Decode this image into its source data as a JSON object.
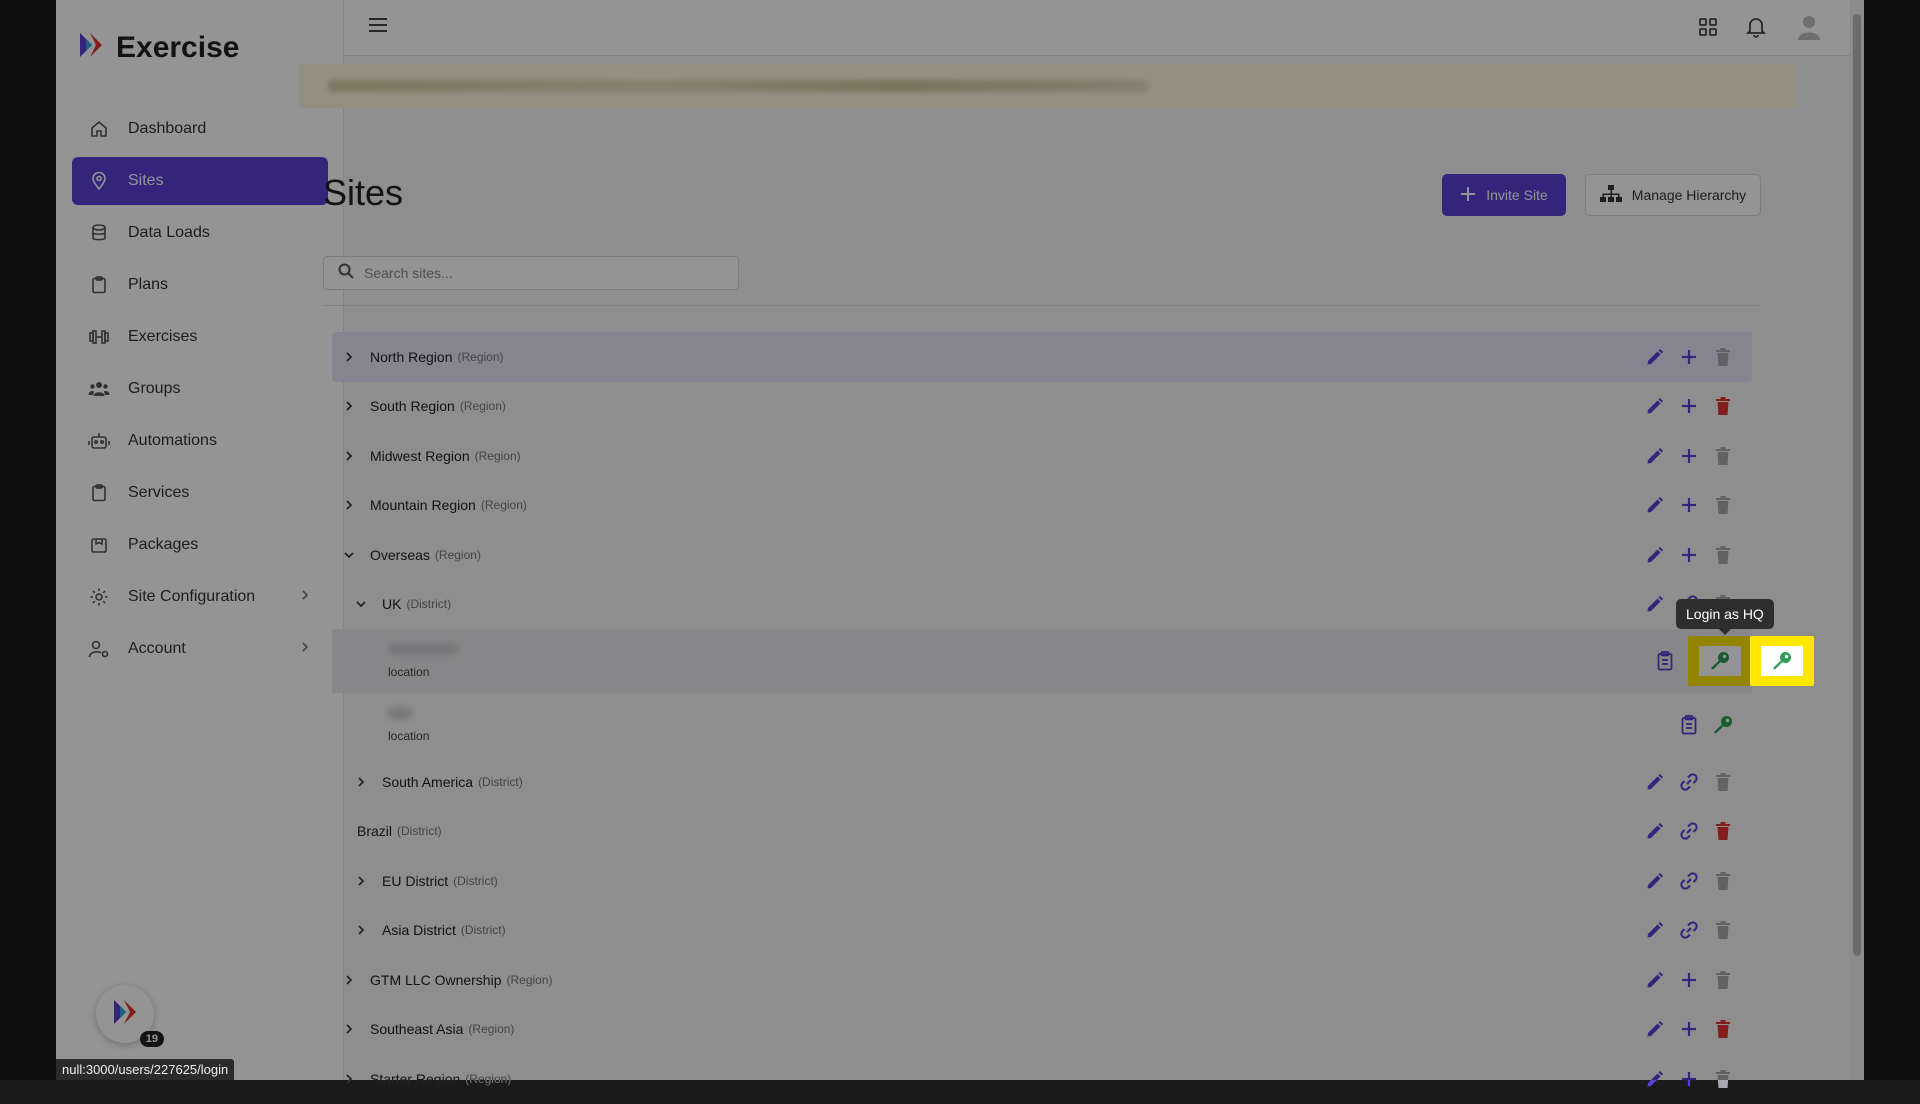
{
  "app": {
    "brand": "Exercise",
    "status_url": "null:3000/users/227625/login",
    "notifications_count": "19"
  },
  "sidebar": {
    "items": [
      {
        "label": "Dashboard",
        "icon": "home-icon",
        "active": false
      },
      {
        "label": "Sites",
        "icon": "map-pin-icon",
        "active": true
      },
      {
        "label": "Data Loads",
        "icon": "database-icon",
        "active": false
      },
      {
        "label": "Plans",
        "icon": "clipboard-icon",
        "active": false
      },
      {
        "label": "Exercises",
        "icon": "dumbbell-icon",
        "active": false
      },
      {
        "label": "Groups",
        "icon": "users-icon",
        "active": false
      },
      {
        "label": "Automations",
        "icon": "robot-icon",
        "active": false
      },
      {
        "label": "Services",
        "icon": "clipboard-icon",
        "active": false
      },
      {
        "label": "Packages",
        "icon": "package-icon",
        "active": false
      },
      {
        "label": "Site Configuration",
        "icon": "gear-icon",
        "active": false,
        "expandable": true
      },
      {
        "label": "Account",
        "icon": "user-gear-icon",
        "active": false,
        "expandable": true
      }
    ]
  },
  "header": {
    "title": "Sites",
    "invite_label": "Invite Site",
    "hierarchy_label": "Manage Hierarchy"
  },
  "search": {
    "placeholder": "Search sites..."
  },
  "tooltip": "Login as HQ",
  "tree": {
    "rows": [
      {
        "name": "North Region",
        "type": "(Region)"
      },
      {
        "name": "South Region",
        "type": "(Region)"
      },
      {
        "name": "Midwest Region",
        "type": "(Region)"
      },
      {
        "name": "Mountain Region",
        "type": "(Region)"
      },
      {
        "name": "Overseas",
        "type": "(Region)"
      },
      {
        "name": "UK",
        "type": "(District)"
      },
      {
        "location_label": "location"
      },
      {
        "location_label": "location"
      },
      {
        "name": "South America",
        "type": "(District)"
      },
      {
        "name": "Brazil",
        "type": "(District)"
      },
      {
        "name": "EU District",
        "type": "(District)"
      },
      {
        "name": "Asia District",
        "type": "(District)"
      },
      {
        "name": "GTM LLC Ownership",
        "type": "(Region)"
      },
      {
        "name": "Southeast Asia",
        "type": "(Region)"
      },
      {
        "name": "Starter Region",
        "type": "(Region)"
      }
    ]
  },
  "colors": {
    "accent": "#5b3fd6",
    "delete_red": "#e0332f",
    "key_green": "#2e9e56",
    "highlight_yellow": "#ffe600"
  }
}
